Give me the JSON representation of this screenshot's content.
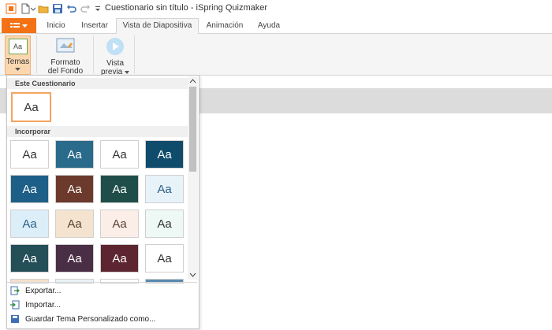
{
  "window": {
    "title": "Cuestionario sin título - iSpring Quizmaker"
  },
  "tabs": [
    "Inicio",
    "Insertar",
    "Vista de Diapositiva",
    "Animación",
    "Ayuda"
  ],
  "ribbon": {
    "temas": "Temas",
    "formato_line1": "Formato",
    "formato_line2": "del Fondo",
    "vista_line1": "Vista",
    "vista_line2": "previa"
  },
  "panel": {
    "section_this": "Este Cuestionario",
    "section_builtin": "Incorporar",
    "sample_text": "Aa",
    "themes": [
      {
        "bg": "#ffffff",
        "text": "#333333"
      },
      {
        "bg": "#2a6a8a",
        "text": "#ffffff"
      },
      {
        "bg": "#ffffff",
        "text": "#333333"
      },
      {
        "bg": "#0f4c6c",
        "text": "#ffffff"
      },
      {
        "bg": "#1d5f86",
        "text": "#ffffff"
      },
      {
        "bg": "#6b3a2c",
        "text": "#ffffff"
      },
      {
        "bg": "#1f4e4a",
        "text": "#ffffff"
      },
      {
        "bg": "#e8f2f9",
        "text": "#2b5f86"
      },
      {
        "bg": "#dceef8",
        "text": "#2b5f86"
      },
      {
        "bg": "#f3e3cf",
        "text": "#5a4030"
      },
      {
        "bg": "#fbeee9",
        "text": "#5a4030"
      },
      {
        "bg": "#eef8f4",
        "text": "#333333"
      },
      {
        "bg": "#244e58",
        "text": "#ffffff"
      },
      {
        "bg": "#4a2e46",
        "text": "#ffffff"
      },
      {
        "bg": "#5d2530",
        "text": "#ffffff"
      },
      {
        "bg": "#ffffff",
        "text": "#333333"
      },
      {
        "bg": "#f3e0cc",
        "text": ""
      },
      {
        "bg": "#e9f2f6",
        "text": ""
      },
      {
        "bg": "#ffffff",
        "text": ""
      },
      {
        "bg": "#5a8ab0",
        "text": ""
      }
    ],
    "footer": [
      "Exportar...",
      "Importar...",
      "Guardar Tema Personalizado como..."
    ]
  },
  "colors": {
    "accent": "#f47216",
    "selected_border": "#f4a460"
  }
}
